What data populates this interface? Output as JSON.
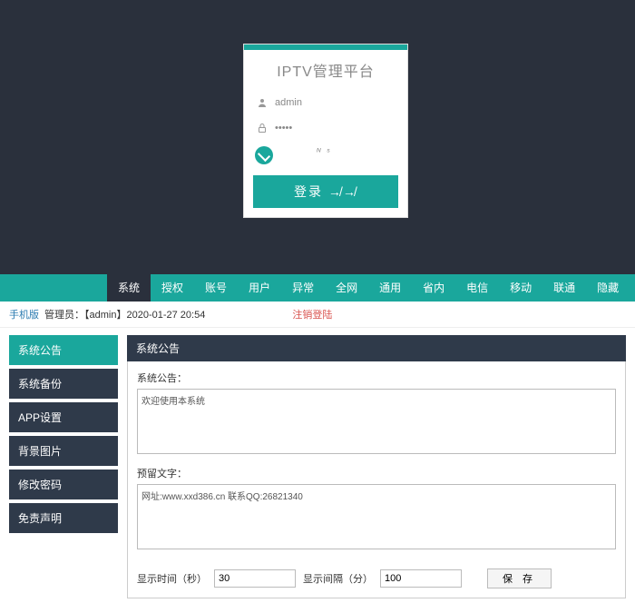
{
  "login": {
    "title": "IPTV管理平台",
    "username": "admin",
    "password": "·····",
    "captcha_text": "ᴺ ˢ",
    "button": "登录 ↛↛"
  },
  "topnav": {
    "items": [
      "系统",
      "授权",
      "账号",
      "用户",
      "异常",
      "全网",
      "通用",
      "省内",
      "电信",
      "移动",
      "联通",
      "隐藏"
    ],
    "active_index": 0
  },
  "infobar": {
    "mobile": "手机版",
    "admin_label": "管理员：",
    "admin_user": "【admin】",
    "datetime": "2020-01-27 20:54",
    "logout": "注销登陆"
  },
  "sidebar": {
    "items": [
      "系统公告",
      "系统备份",
      "APP设置",
      "背景图片",
      "修改密码",
      "免责声明"
    ],
    "active_index": 0
  },
  "panel": {
    "header": "系统公告",
    "label1": "系统公告：",
    "textarea1": "欢迎使用本系统",
    "label2": "预留文字：",
    "textarea2": "网址:www.xxd386.cn 联系QQ:26821340",
    "display_time_label": "显示时间（秒）",
    "display_time_value": "30",
    "display_gap_label": "显示间隔（分）",
    "display_gap_value": "100",
    "save": "保 存"
  }
}
